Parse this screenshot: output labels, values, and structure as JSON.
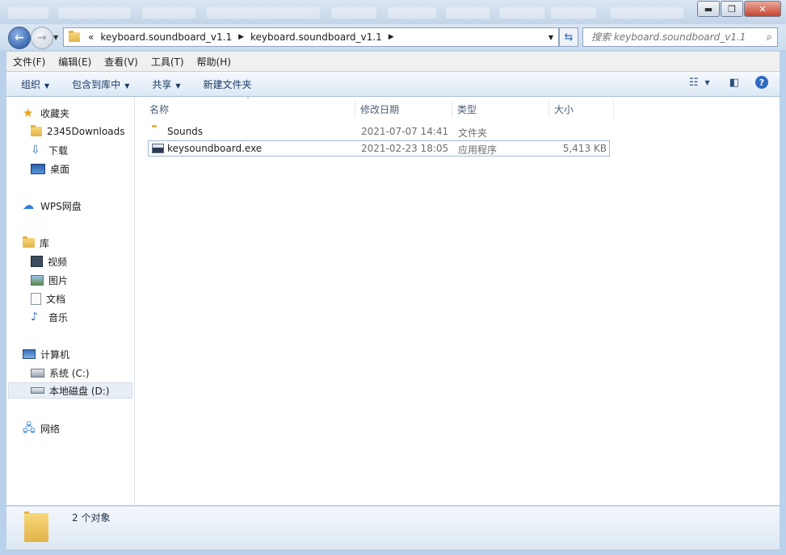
{
  "window": {
    "controls": {
      "minimize": "▬",
      "maximize": "❐",
      "close": "✕"
    }
  },
  "address": {
    "overflow": "«",
    "crumbs": [
      "keyboard.soundboard_v1.1",
      "keyboard.soundboard_v1.1"
    ],
    "search_placeholder": "搜索 keyboard.soundboard_v1.1"
  },
  "menu": [
    "文件(F)",
    "编辑(E)",
    "查看(V)",
    "工具(T)",
    "帮助(H)"
  ],
  "toolbar": {
    "organize": "组织",
    "include_library": "包含到库中",
    "share": "共享",
    "new_folder": "新建文件夹"
  },
  "nav": {
    "favorites": "收藏夹",
    "downloads_2345": "2345Downloads",
    "downloads": "下载",
    "desktop": "桌面",
    "wps": "WPS网盘",
    "libraries": "库",
    "videos": "视频",
    "pictures": "图片",
    "documents": "文档",
    "music": "音乐",
    "computer": "计算机",
    "drive_c": "系统 (C:)",
    "drive_d": "本地磁盘 (D:)",
    "network": "网络"
  },
  "columns": {
    "name": "名称",
    "modified": "修改日期",
    "type": "类型",
    "size": "大小"
  },
  "files": [
    {
      "name": "Sounds",
      "modified": "2021-07-07 14:41",
      "type": "文件夹",
      "size": ""
    },
    {
      "name": "keysoundboard.exe",
      "modified": "2021-02-23 18:05",
      "type": "应用程序",
      "size": "5,413 KB"
    }
  ],
  "status": {
    "count": "2 个对象"
  },
  "colors": {
    "chrome": "#b9d1ea",
    "toolbar_text": "#1a3a66",
    "selection_border": "#9fb8d9"
  }
}
